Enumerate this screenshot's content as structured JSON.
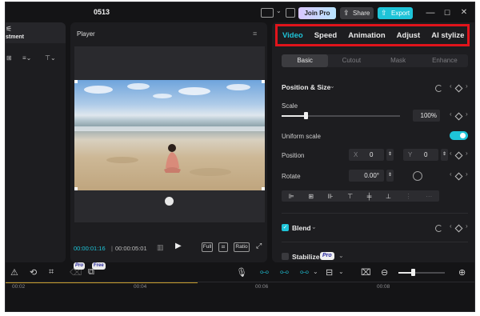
{
  "titlebar": {
    "project_name": "0513",
    "join_pro_label": "Join Pro",
    "share_label": "Share",
    "export_label": "Export",
    "minimize": "—",
    "maximize": "☐",
    "close": "✕"
  },
  "left_panel": {
    "tab_label": "stment"
  },
  "player": {
    "title": "Player",
    "current_time": "00:00:01:16",
    "separator": "|",
    "total_time": "00:00:05:01",
    "full_label": "Full",
    "ratio_label": "Ratio"
  },
  "right_panel": {
    "tabs": [
      "Video",
      "Speed",
      "Animation",
      "Adjust",
      "AI stylize"
    ],
    "active_tab": 0,
    "subtabs": [
      "Basic",
      "Cutout",
      "Mask",
      "Enhance"
    ],
    "active_subtab": 0,
    "position_size_title": "Position & Size",
    "scale_label": "Scale",
    "scale_value": "100%",
    "scale_level": 0.2,
    "uniform_scale_label": "Uniform scale",
    "uniform_scale_on": true,
    "position_label": "Position",
    "x_label": "X",
    "x_value": "0",
    "y_label": "Y",
    "y_value": "0",
    "rotate_label": "Rotate",
    "rotate_value": "0.00°",
    "blend_label": "Blend",
    "stabilize_label": "Stabilize",
    "pro_badge": "Pro"
  },
  "timeline": {
    "pro_badge": "Pro",
    "free_badge": "Free",
    "ticks": [
      "00:02",
      "00:04",
      "00:06",
      "00:08"
    ]
  },
  "colors": {
    "accent": "#1ec4d8",
    "highlight_border": "#e0141b",
    "panel": "#1d1d20",
    "background": "#141416"
  }
}
